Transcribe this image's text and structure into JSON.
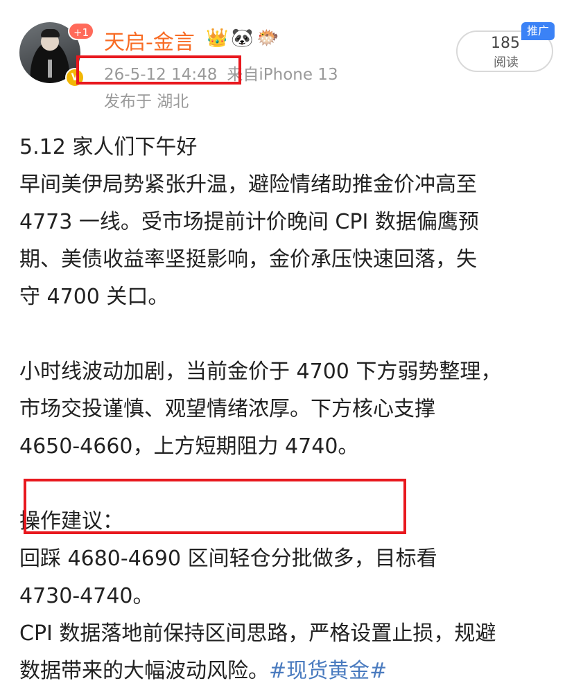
{
  "post": {
    "author": {
      "name": "天启-金言",
      "badge_count": "+1",
      "verified_mark": "V",
      "emoji_icons": [
        "crown-icon",
        "panda-icon",
        "fish-icon"
      ]
    },
    "timestamp": "26-5-12 14:48",
    "source": "来自iPhone 13",
    "location": "发布于 湖北",
    "read_count": "185",
    "read_label": "阅读",
    "promo_tag": "推广",
    "content": {
      "p1": [
        "5.12 家人们下午好",
        "早间美伊局势紧张升温，避险情绪助推金价冲高至",
        "4773 一线。受市场提前计价晚间 CPI 数据偏鹰预",
        "期、美债收益率坚挺影响，金价承压快速回落，失",
        "守 4700 关口。"
      ],
      "p2": [
        "小时线波动加剧，当前金价于 4700 下方弱势整理，",
        "市场交投谨慎、观望情绪浓厚。下方核心支撑",
        "4650-4660，上方短期阻力 4740。"
      ],
      "p3": [
        "操作建议：",
        "回踩 4680-4690 区间轻仓分批做多，目标看",
        "4730-4740。",
        "CPI 数据落地前保持区间思路，严格设置止损，规避"
      ],
      "last_line": "数据带来的大幅波动风险。",
      "topic": "#现货黄金#"
    }
  },
  "colors": {
    "username": "#f86c25",
    "meta_gray": "#9a9a9a",
    "highlight_red": "#e8181e",
    "topic_blue": "#4a7bbf",
    "promo_blue": "#3b82f6"
  }
}
